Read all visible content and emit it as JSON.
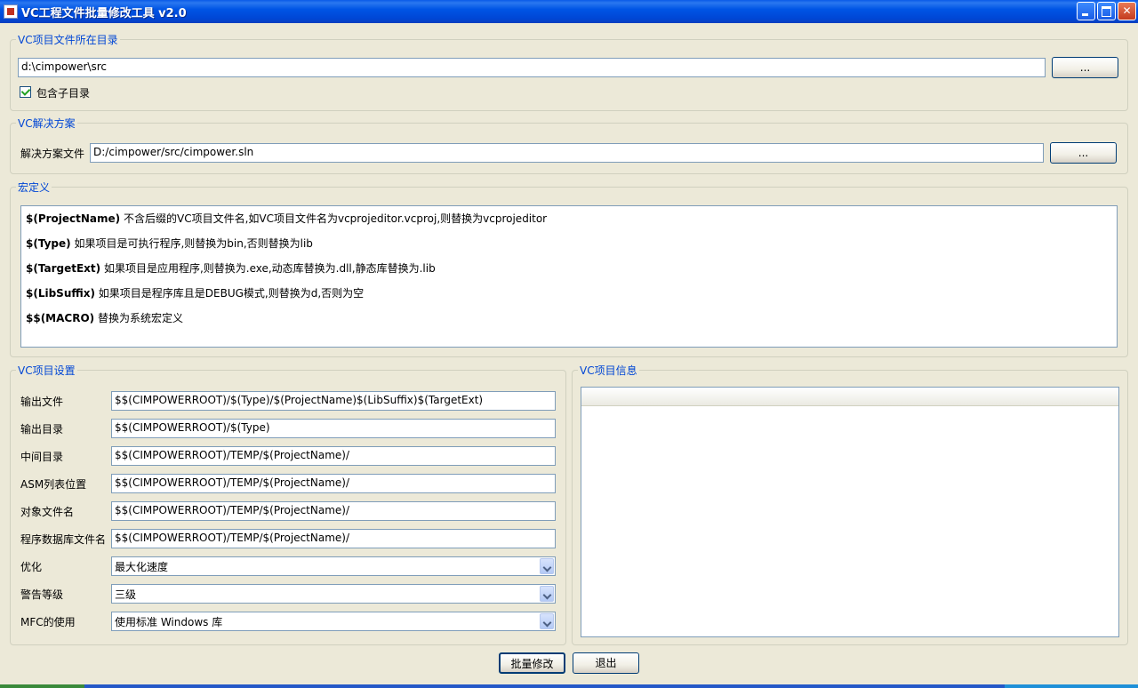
{
  "window": {
    "title": "VC工程文件批量修改工具 v2.0"
  },
  "directory_group": {
    "title": "VC项目文件所在目录",
    "path": "d:\\cimpower\\src",
    "browse_label": "...",
    "include_subdirs_label": "包含子目录",
    "include_subdirs_checked": true
  },
  "solution_group": {
    "title": "VC解决方案",
    "file_label": "解决方案文件",
    "file_path": "D:/cimpower/src/cimpower.sln",
    "browse_label": "..."
  },
  "macro_group": {
    "title": "宏定义",
    "items": [
      {
        "key": "$(ProjectName)",
        "desc": " 不含后缀的VC项目文件名,如VC项目文件名为vcprojeditor.vcproj,则替换为vcprojeditor"
      },
      {
        "key": "$(Type)",
        "desc": " 如果项目是可执行程序,则替换为bin,否则替换为lib"
      },
      {
        "key": "$(TargetExt)",
        "desc": " 如果项目是应用程序,则替换为.exe,动态库替换为.dll,静态库替换为.lib"
      },
      {
        "key": "$(LibSuffix)",
        "desc": " 如果项目是程序库且是DEBUG模式,则替换为d,否则为空"
      },
      {
        "key": "$$(MACRO)",
        "desc": " 替换为系统宏定义"
      }
    ]
  },
  "settings_group": {
    "title": "VC项目设置",
    "fields": [
      {
        "label": "输出文件",
        "value": "$$(CIMPOWERROOT)/$(Type)/$(ProjectName)$(LibSuffix)$(TargetExt)"
      },
      {
        "label": "输出目录",
        "value": "$$(CIMPOWERROOT)/$(Type)"
      },
      {
        "label": "中间目录",
        "value": "$$(CIMPOWERROOT)/TEMP/$(ProjectName)/"
      },
      {
        "label": "ASM列表位置",
        "value": "$$(CIMPOWERROOT)/TEMP/$(ProjectName)/"
      },
      {
        "label": "对象文件名",
        "value": "$$(CIMPOWERROOT)/TEMP/$(ProjectName)/"
      },
      {
        "label": "程序数据库文件名",
        "value": "$$(CIMPOWERROOT)/TEMP/$(ProjectName)/"
      }
    ],
    "combos": [
      {
        "label": "优化",
        "value": "最大化速度"
      },
      {
        "label": "警告等级",
        "value": "三级"
      },
      {
        "label": "MFC的使用",
        "value": "使用标准 Windows 库"
      }
    ]
  },
  "info_group": {
    "title": "VC项目信息"
  },
  "actions": {
    "batch_modify_label": "批量修改",
    "exit_label": "退出"
  },
  "colors": {
    "titlebar": "#0055e5",
    "group_title": "#0046d5",
    "window_bg": "#ece9d8"
  }
}
